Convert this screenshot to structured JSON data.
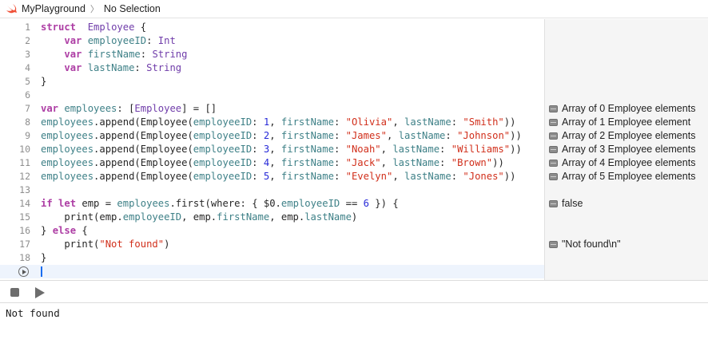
{
  "breadcrumb": {
    "project": "MyPlayground",
    "selection": "No Selection"
  },
  "colors": {
    "keyword": "#ad3da4",
    "type": "#703daa",
    "property": "#3e8087",
    "string": "#d12f1b",
    "number": "#272ad8",
    "line_number": "#8e8e8e"
  },
  "code_lines": [
    {
      "n": "1",
      "segments": [
        [
          "kw",
          "struct"
        ],
        [
          "",
          "  "
        ],
        [
          "ty",
          "Employee"
        ],
        [
          "",
          " {"
        ]
      ]
    },
    {
      "n": "2",
      "segments": [
        [
          "",
          "    "
        ],
        [
          "kw",
          "var"
        ],
        [
          "",
          " "
        ],
        [
          "pr",
          "employeeID"
        ],
        [
          "",
          ": "
        ],
        [
          "ty",
          "Int"
        ]
      ]
    },
    {
      "n": "3",
      "segments": [
        [
          "",
          "    "
        ],
        [
          "kw",
          "var"
        ],
        [
          "",
          " "
        ],
        [
          "pr",
          "firstName"
        ],
        [
          "",
          ": "
        ],
        [
          "ty",
          "String"
        ]
      ]
    },
    {
      "n": "4",
      "segments": [
        [
          "",
          "    "
        ],
        [
          "kw",
          "var"
        ],
        [
          "",
          " "
        ],
        [
          "pr",
          "lastName"
        ],
        [
          "",
          ": "
        ],
        [
          "ty",
          "String"
        ]
      ]
    },
    {
      "n": "5",
      "segments": [
        [
          "",
          "}"
        ]
      ]
    },
    {
      "n": "6",
      "segments": []
    },
    {
      "n": "7",
      "segments": [
        [
          "kw",
          "var"
        ],
        [
          "",
          " "
        ],
        [
          "pr",
          "employees"
        ],
        [
          "",
          ": ["
        ],
        [
          "ty",
          "Employee"
        ],
        [
          "",
          "] = []"
        ]
      ]
    },
    {
      "n": "8",
      "segments": [
        [
          "pr",
          "employees"
        ],
        [
          "",
          ".append(Employee("
        ],
        [
          "pr",
          "employeeID"
        ],
        [
          "",
          ": "
        ],
        [
          "nu",
          "1"
        ],
        [
          "",
          ", "
        ],
        [
          "pr",
          "firstName"
        ],
        [
          "",
          ": "
        ],
        [
          "st",
          "\"Olivia\""
        ],
        [
          "",
          ", "
        ],
        [
          "pr",
          "lastName"
        ],
        [
          "",
          ": "
        ],
        [
          "st",
          "\"Smith\""
        ],
        [
          "",
          "))"
        ]
      ]
    },
    {
      "n": "9",
      "segments": [
        [
          "pr",
          "employees"
        ],
        [
          "",
          ".append(Employee("
        ],
        [
          "pr",
          "employeeID"
        ],
        [
          "",
          ": "
        ],
        [
          "nu",
          "2"
        ],
        [
          "",
          ", "
        ],
        [
          "pr",
          "firstName"
        ],
        [
          "",
          ": "
        ],
        [
          "st",
          "\"James\""
        ],
        [
          "",
          ", "
        ],
        [
          "pr",
          "lastName"
        ],
        [
          "",
          ": "
        ],
        [
          "st",
          "\"Johnson\""
        ],
        [
          "",
          "))"
        ]
      ]
    },
    {
      "n": "10",
      "segments": [
        [
          "pr",
          "employees"
        ],
        [
          "",
          ".append(Employee("
        ],
        [
          "pr",
          "employeeID"
        ],
        [
          "",
          ": "
        ],
        [
          "nu",
          "3"
        ],
        [
          "",
          ", "
        ],
        [
          "pr",
          "firstName"
        ],
        [
          "",
          ": "
        ],
        [
          "st",
          "\"Noah\""
        ],
        [
          "",
          ", "
        ],
        [
          "pr",
          "lastName"
        ],
        [
          "",
          ": "
        ],
        [
          "st",
          "\"Williams\""
        ],
        [
          "",
          "))"
        ]
      ]
    },
    {
      "n": "11",
      "segments": [
        [
          "pr",
          "employees"
        ],
        [
          "",
          ".append(Employee("
        ],
        [
          "pr",
          "employeeID"
        ],
        [
          "",
          ": "
        ],
        [
          "nu",
          "4"
        ],
        [
          "",
          ", "
        ],
        [
          "pr",
          "firstName"
        ],
        [
          "",
          ": "
        ],
        [
          "st",
          "\"Jack\""
        ],
        [
          "",
          ", "
        ],
        [
          "pr",
          "lastName"
        ],
        [
          "",
          ": "
        ],
        [
          "st",
          "\"Brown\""
        ],
        [
          "",
          "))"
        ]
      ]
    },
    {
      "n": "12",
      "segments": [
        [
          "pr",
          "employees"
        ],
        [
          "",
          ".append(Employee("
        ],
        [
          "pr",
          "employeeID"
        ],
        [
          "",
          ": "
        ],
        [
          "nu",
          "5"
        ],
        [
          "",
          ", "
        ],
        [
          "pr",
          "firstName"
        ],
        [
          "",
          ": "
        ],
        [
          "st",
          "\"Evelyn\""
        ],
        [
          "",
          ", "
        ],
        [
          "pr",
          "lastName"
        ],
        [
          "",
          ": "
        ],
        [
          "st",
          "\"Jones\""
        ],
        [
          "",
          "))"
        ]
      ]
    },
    {
      "n": "13",
      "segments": []
    },
    {
      "n": "14",
      "segments": [
        [
          "kw",
          "if"
        ],
        [
          "",
          " "
        ],
        [
          "kw",
          "let"
        ],
        [
          "",
          " emp = "
        ],
        [
          "pr",
          "employees"
        ],
        [
          "",
          ".first(where: { $0."
        ],
        [
          "pr",
          "employeeID"
        ],
        [
          "",
          " == "
        ],
        [
          "nu",
          "6"
        ],
        [
          "",
          " }) {"
        ]
      ]
    },
    {
      "n": "15",
      "segments": [
        [
          "",
          "    print(emp."
        ],
        [
          "pr",
          "employeeID"
        ],
        [
          "",
          ", emp."
        ],
        [
          "pr",
          "firstName"
        ],
        [
          "",
          ", emp."
        ],
        [
          "pr",
          "lastName"
        ],
        [
          "",
          ")"
        ]
      ]
    },
    {
      "n": "16",
      "segments": [
        [
          "",
          "} "
        ],
        [
          "kw",
          "else"
        ],
        [
          "",
          " {"
        ]
      ]
    },
    {
      "n": "17",
      "segments": [
        [
          "",
          "    print("
        ],
        [
          "st",
          "\"Not found\""
        ],
        [
          "",
          ")"
        ]
      ]
    },
    {
      "n": "18",
      "segments": [
        [
          "",
          "}"
        ]
      ]
    }
  ],
  "results": [
    {
      "line": 7,
      "text": "Array of 0 Employee elements"
    },
    {
      "line": 8,
      "text": "Array of 1 Employee element"
    },
    {
      "line": 9,
      "text": "Array of 2 Employee elements"
    },
    {
      "line": 10,
      "text": "Array of 3 Employee elements"
    },
    {
      "line": 11,
      "text": "Array of 4 Employee elements"
    },
    {
      "line": 12,
      "text": "Array of 5 Employee elements"
    },
    {
      "line": 14,
      "text": "false"
    },
    {
      "line": 17,
      "text": "\"Not found\\n\""
    }
  ],
  "console": {
    "output": "Not found"
  }
}
